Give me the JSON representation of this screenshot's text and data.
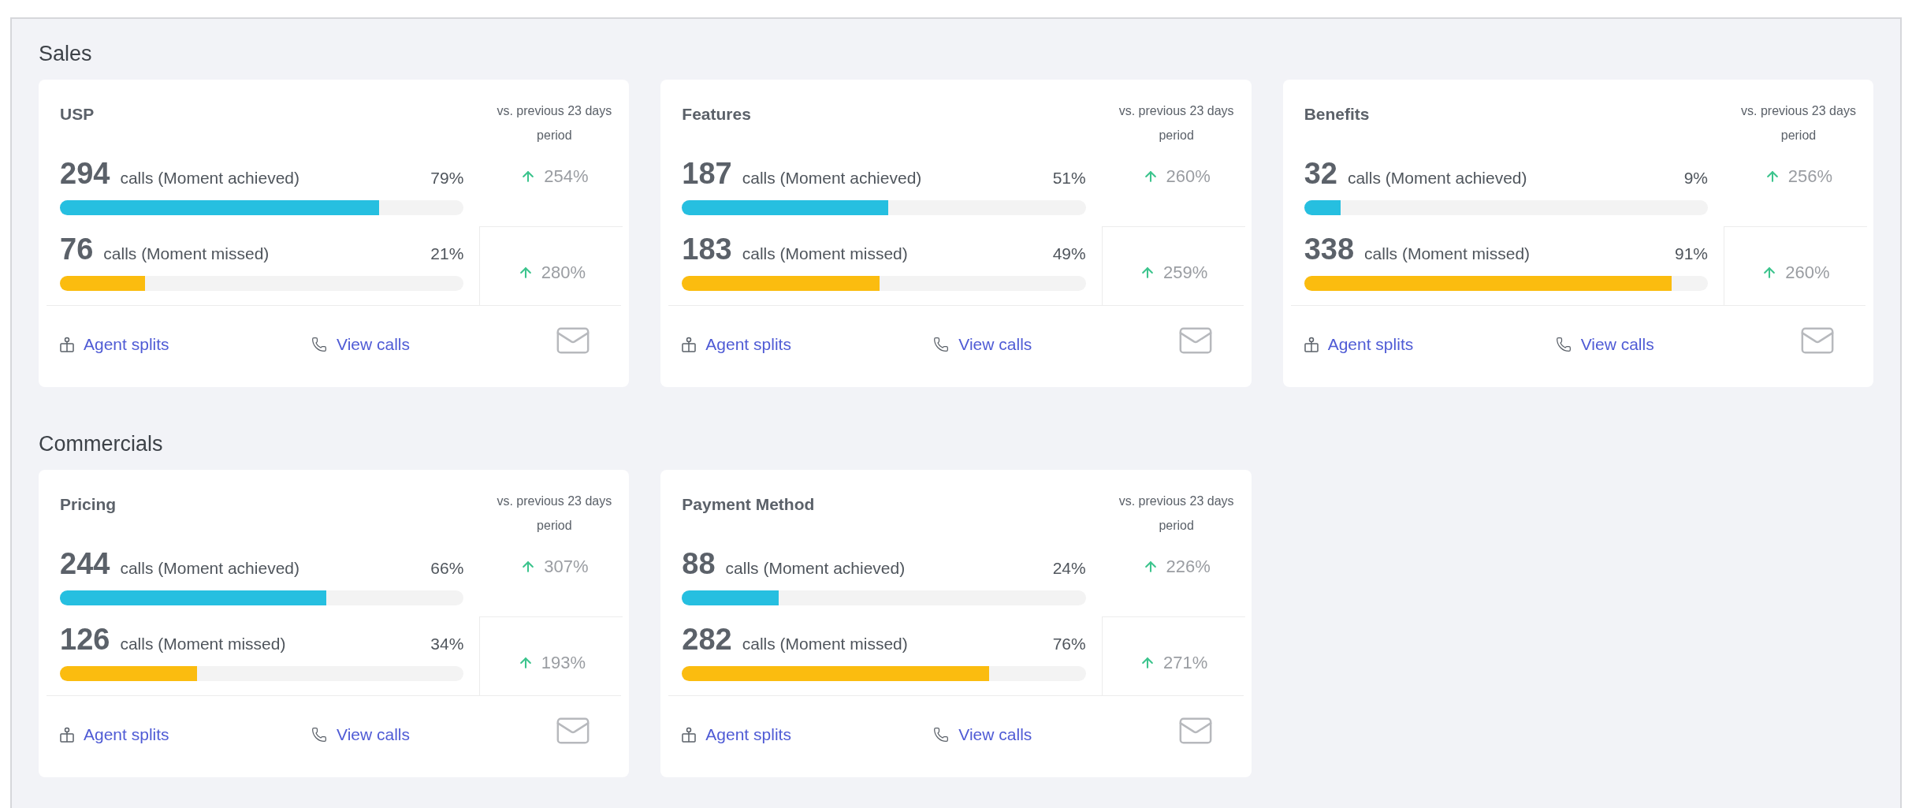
{
  "sections": [
    {
      "title": "Sales",
      "cards": [
        {
          "title": "USP",
          "comparison_label": "vs. previous 23 days period",
          "rows": [
            {
              "kind": "achieved",
              "count": "294",
              "label": "calls (Moment achieved)",
              "percent": "79%",
              "level": 0.79,
              "change": "254%"
            },
            {
              "kind": "missed",
              "count": "76",
              "label": "calls (Moment missed)",
              "percent": "21%",
              "level": 0.21,
              "change": "280%"
            }
          ],
          "links": [
            "Agent splits",
            "View calls"
          ]
        },
        {
          "title": "Features",
          "comparison_label": "vs. previous 23 days period",
          "rows": [
            {
              "kind": "achieved",
              "count": "187",
              "label": "calls (Moment achieved)",
              "percent": "51%",
              "level": 0.51,
              "change": "260%"
            },
            {
              "kind": "missed",
              "count": "183",
              "label": "calls (Moment missed)",
              "percent": "49%",
              "level": 0.49,
              "change": "259%"
            }
          ],
          "links": [
            "Agent splits",
            "View calls"
          ]
        },
        {
          "title": "Benefits",
          "comparison_label": "vs. previous 23 days period",
          "rows": [
            {
              "kind": "achieved",
              "count": "32",
              "label": "calls (Moment achieved)",
              "percent": "9%",
              "level": 0.09,
              "change": "256%"
            },
            {
              "kind": "missed",
              "count": "338",
              "label": "calls (Moment missed)",
              "percent": "91%",
              "level": 0.91,
              "change": "260%"
            }
          ],
          "links": [
            "Agent splits",
            "View calls"
          ]
        }
      ]
    },
    {
      "title": "Commercials",
      "cards": [
        {
          "title": "Pricing",
          "comparison_label": "vs. previous 23 days period",
          "rows": [
            {
              "kind": "achieved",
              "count": "244",
              "label": "calls (Moment achieved)",
              "percent": "66%",
              "level": 0.66,
              "change": "307%"
            },
            {
              "kind": "missed",
              "count": "126",
              "label": "calls (Moment missed)",
              "percent": "34%",
              "level": 0.34,
              "change": "193%"
            }
          ],
          "links": [
            "Agent splits",
            "View calls"
          ]
        },
        {
          "title": "Payment Method",
          "comparison_label": "vs. previous 23 days period",
          "rows": [
            {
              "kind": "achieved",
              "count": "88",
              "label": "calls (Moment achieved)",
              "percent": "24%",
              "level": 0.24,
              "change": "226%"
            },
            {
              "kind": "missed",
              "count": "282",
              "label": "calls (Moment missed)",
              "percent": "76%",
              "level": 0.76,
              "change": "271%"
            }
          ],
          "links": [
            "Agent splits",
            "View calls"
          ]
        }
      ]
    }
  ]
}
